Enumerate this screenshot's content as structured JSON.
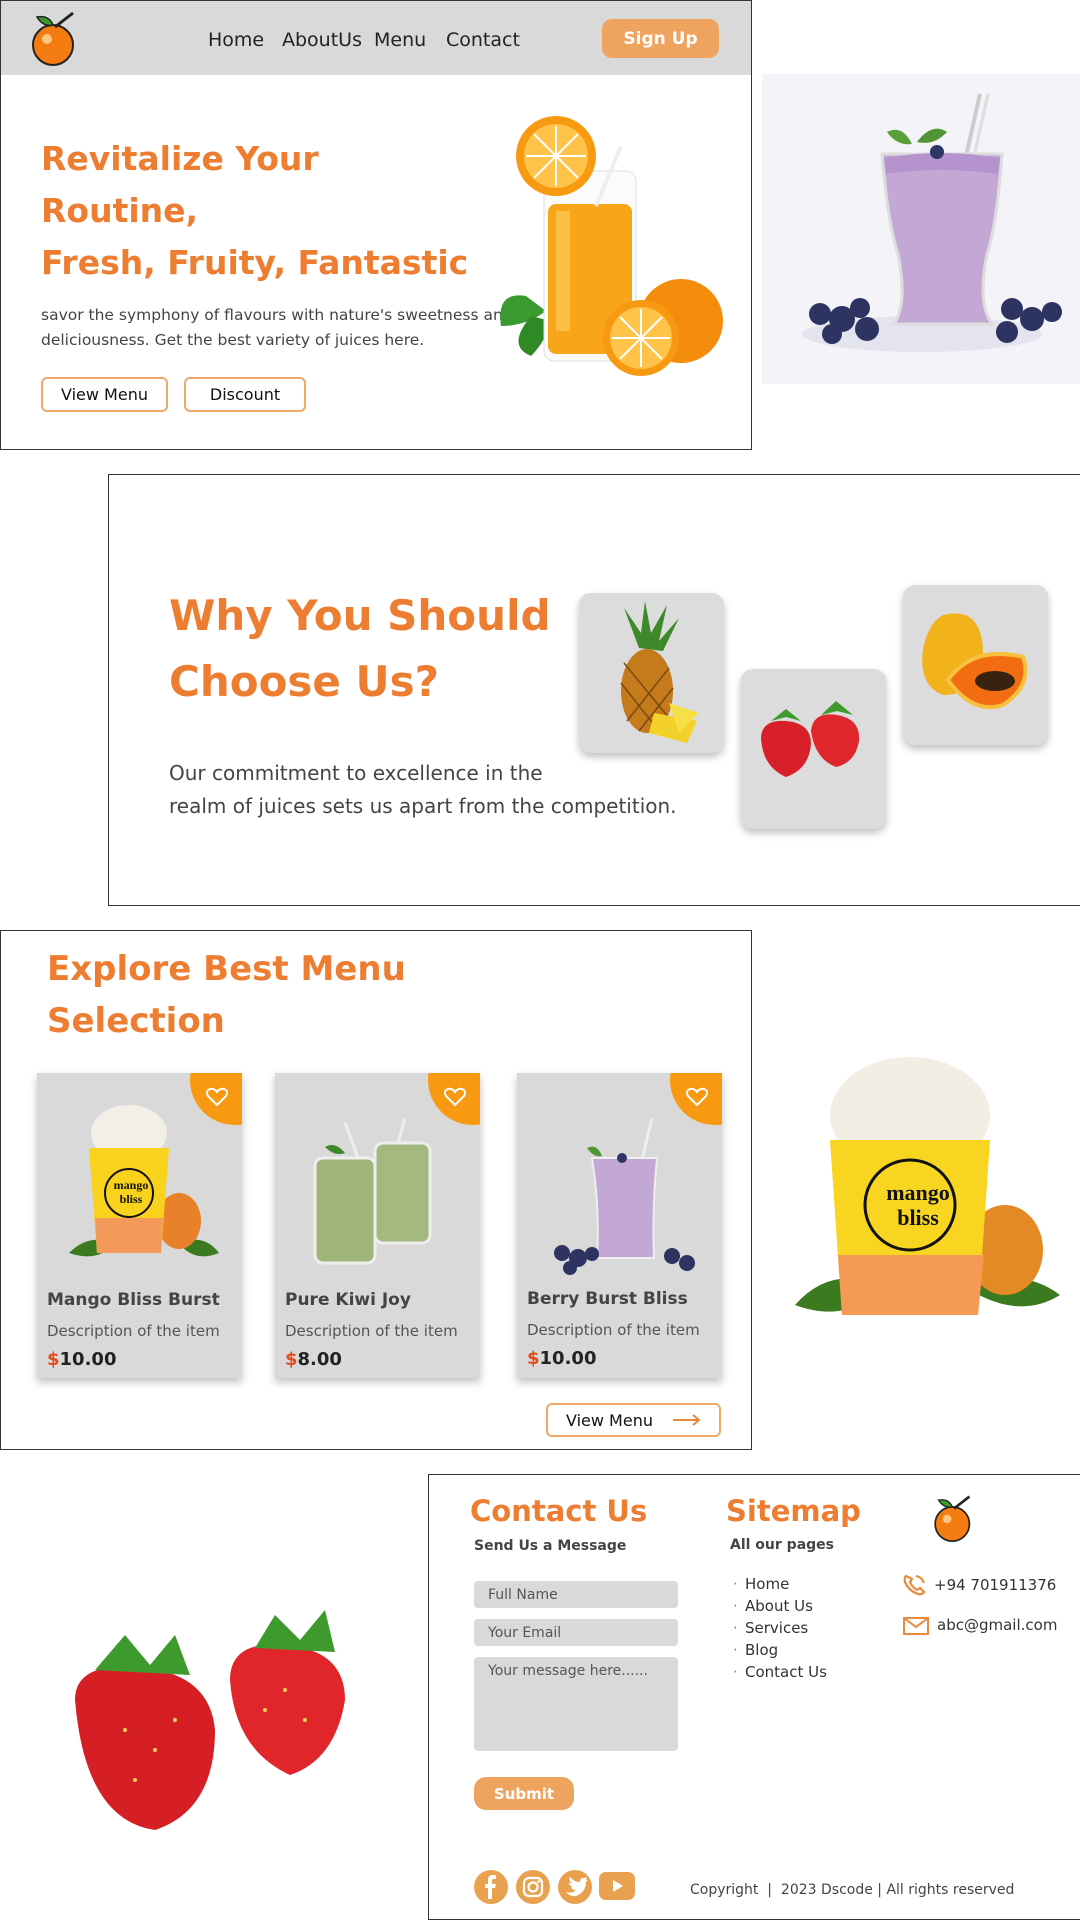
{
  "header": {
    "nav": [
      "Home",
      "AboutUs",
      "Menu",
      "Contact"
    ],
    "signup_label": "Sign Up"
  },
  "hero": {
    "title_line1": "Revitalize Your",
    "title_line2": "Routine,",
    "title_line3": "Fresh, Fruity, Fantastic",
    "desc_line1": "savor the symphony of flavours with nature's sweetness and",
    "desc_line2": "deliciousness. Get the best variety of juices here.",
    "view_menu_label": "View Menu",
    "discount_label": "Discount"
  },
  "why": {
    "title_line1": "Why You Should",
    "title_line2": "Choose Us?",
    "desc_line1": "Our commitment to excellence in the",
    "desc_line2": "realm of juices sets us apart from the competition."
  },
  "menu": {
    "title_line1": "Explore Best Menu",
    "title_line2": "Selection",
    "items": [
      {
        "name": "Mango Bliss Burst",
        "desc": "Description of the item",
        "currency": "$",
        "price": "10.00"
      },
      {
        "name": "Pure Kiwi Joy",
        "desc": "Description of the item",
        "currency": "$",
        "price": "8.00"
      },
      {
        "name": "Berry Burst Bliss",
        "desc": "Description of the item",
        "currency": "$",
        "price": "10.00"
      }
    ],
    "view_menu_label": "View Menu",
    "mango_logo_line1": "mango",
    "mango_logo_line2": "bliss"
  },
  "contact": {
    "title": "Contact Us",
    "subtitle": "Send Us a Message",
    "name_placeholder": "Full Name",
    "email_placeholder": "Your Email",
    "message_placeholder": "Your message here......",
    "submit_label": "Submit"
  },
  "sitemap": {
    "title": "Sitemap",
    "subtitle": "All our pages",
    "items": [
      "Home",
      "About Us",
      "Services",
      "Blog",
      "Contact Us"
    ]
  },
  "contact_info": {
    "phone": "+94 701911376",
    "email": "abc@gmail.com"
  },
  "footer": {
    "copyright": "Copyright  |  2023 Dscode | All rights reserved"
  },
  "colors": {
    "accent": "#ed7d31",
    "button": "#eea45e",
    "card_bg": "#d9d9d9"
  }
}
